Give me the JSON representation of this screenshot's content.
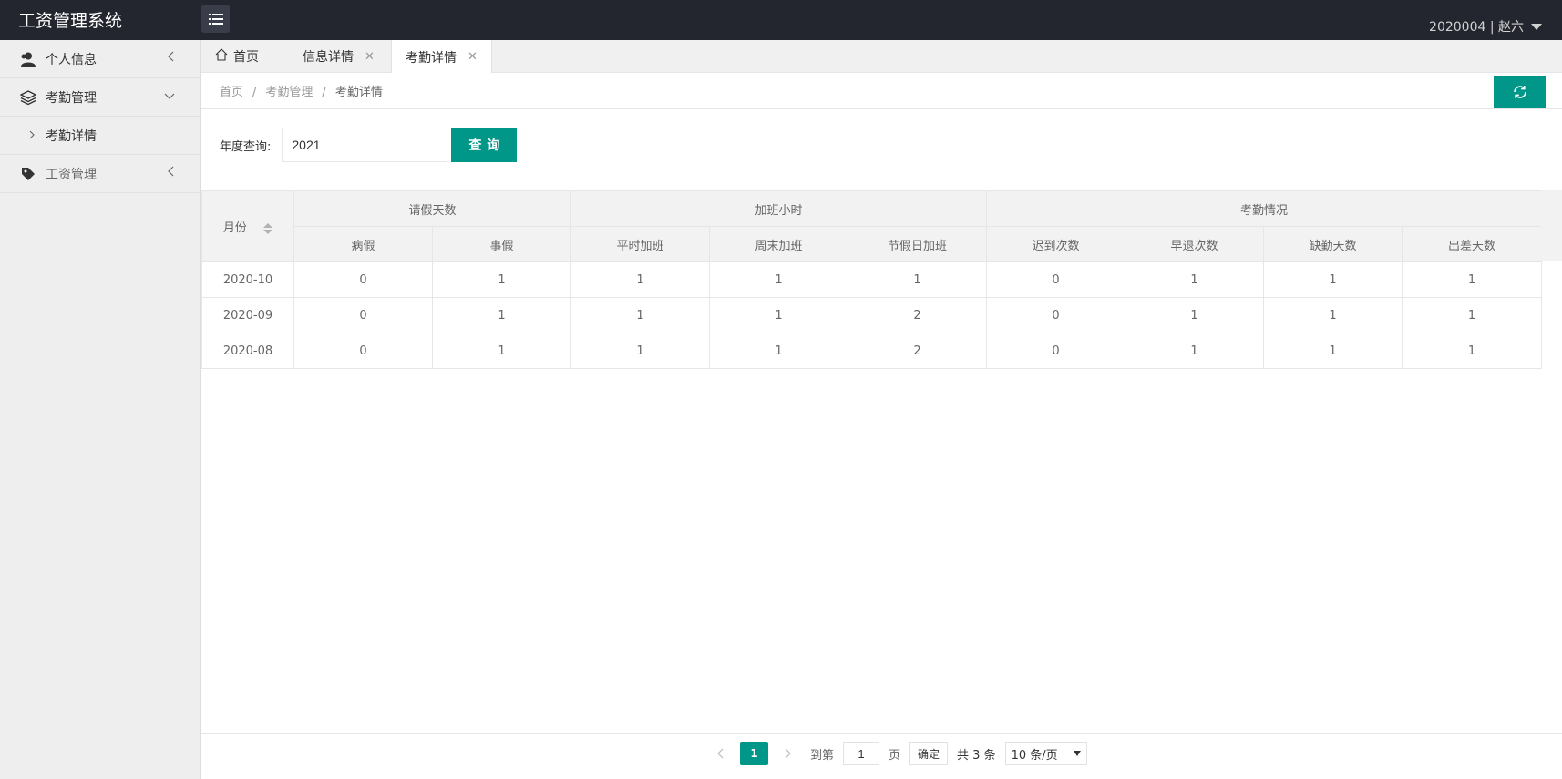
{
  "header": {
    "app_title": "工资管理系统",
    "user": "2020004 | 赵六"
  },
  "sidebar": {
    "items": [
      {
        "label": "个人信息",
        "icon": "user-icon"
      },
      {
        "label": "考勤管理",
        "icon": "layers-icon",
        "expanded": true,
        "children": [
          {
            "label": "考勤详情"
          }
        ]
      },
      {
        "label": "工资管理",
        "icon": "tag-icon"
      }
    ]
  },
  "tabs": [
    {
      "label": "首页",
      "icon": "home-icon"
    },
    {
      "label": "信息详情"
    },
    {
      "label": "考勤详情",
      "active": true
    }
  ],
  "breadcrumb": [
    "首页",
    "考勤管理",
    "考勤详情"
  ],
  "search": {
    "label": "年度查询:",
    "value": "2021",
    "button": "查询"
  },
  "table": {
    "groups": [
      "请假天数",
      "加班小时",
      "考勤情况"
    ],
    "month_header": "月份",
    "columns": [
      "病假",
      "事假",
      "平时加班",
      "周末加班",
      "节假日加班",
      "迟到次数",
      "早退次数",
      "缺勤天数",
      "出差天数"
    ],
    "rows": [
      {
        "month": "2020-10",
        "values": [
          "0",
          "1",
          "1",
          "1",
          "1",
          "0",
          "1",
          "1",
          "1"
        ]
      },
      {
        "month": "2020-09",
        "values": [
          "0",
          "1",
          "1",
          "1",
          "2",
          "0",
          "1",
          "1",
          "1"
        ]
      },
      {
        "month": "2020-08",
        "values": [
          "0",
          "1",
          "1",
          "1",
          "2",
          "0",
          "1",
          "1",
          "1"
        ]
      }
    ]
  },
  "pagination": {
    "current_page": "1",
    "goto_label": "到第",
    "page_input": "1",
    "page_suffix": "页",
    "confirm": "确定",
    "total": "共 3 条",
    "page_size": "10 条/页"
  },
  "colors": {
    "accent": "#009688",
    "header_bg": "#23262e"
  }
}
